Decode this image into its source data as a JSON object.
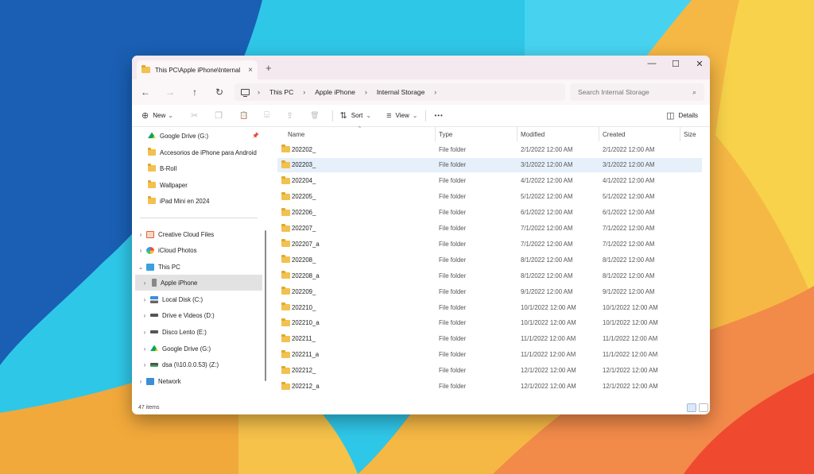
{
  "window": {
    "tab_title": "This PC\\Apple iPhone\\Internal",
    "close_tab_glyph": "×",
    "new_tab_glyph": "+",
    "minimize_glyph": "—",
    "maximize_glyph": "☐",
    "close_glyph": "✕"
  },
  "nav": {
    "back_glyph": "←",
    "forward_glyph": "→",
    "up_glyph": "↑",
    "refresh_glyph": "↻",
    "separator_glyph": "›",
    "breadcrumbs": [
      "This PC",
      "Apple iPhone",
      "Internal Storage"
    ],
    "search_placeholder": "Search Internal Storage",
    "search_glyph": "⌕"
  },
  "toolbar": {
    "new_glyph": "⊕",
    "new_label": "New",
    "dropdown_glyph": "⌄",
    "cut_glyph": "✂",
    "copy_glyph": "❐",
    "paste_glyph": "📋",
    "rename_glyph": "⌸",
    "share_glyph": "⇪",
    "delete_glyph": "🗑",
    "sort_glyph": "⇅",
    "sort_label": "Sort",
    "view_glyph": "≡",
    "view_label": "View",
    "more_glyph": "•••",
    "details_glyph": "◫",
    "details_label": "Details"
  },
  "sidebar": {
    "chevron_right": "›",
    "chevron_down": "⌄",
    "pin_glyph": "📌",
    "quick_access": [
      {
        "label": "Google Drive (G:)",
        "icon": "google-drive-icon",
        "pinned": true
      },
      {
        "label": "Accesorios de iPhone para Android",
        "icon": "folder-icon"
      },
      {
        "label": "B-Roll",
        "icon": "folder-icon"
      },
      {
        "label": "Wallpaper",
        "icon": "folder-icon"
      },
      {
        "label": "iPad Mini en 2024",
        "icon": "folder-icon"
      }
    ],
    "tree": [
      {
        "label": "Creative Cloud Files",
        "icon": "creative-cloud-icon"
      },
      {
        "label": "iCloud Photos",
        "icon": "icloud-photos-icon"
      },
      {
        "label": "This PC",
        "icon": "this-pc-icon",
        "expanded": true
      },
      {
        "label": "Apple iPhone",
        "icon": "iphone-icon",
        "selected": true
      },
      {
        "label": "Local Disk (C:)",
        "icon": "local-disk-icon"
      },
      {
        "label": "Drive e Videos (D:)",
        "icon": "drive-icon"
      },
      {
        "label": "Disco Lento (E:)",
        "icon": "drive-icon"
      },
      {
        "label": "Google Drive (G:)",
        "icon": "google-drive-icon"
      },
      {
        "label": "dsa (\\\\10.0.0.53) (Z:)",
        "icon": "network-drive-icon"
      },
      {
        "label": "Network",
        "icon": "network-icon"
      }
    ]
  },
  "file_list": {
    "sort_caret": "^",
    "columns": [
      "Name",
      "Type",
      "Modified",
      "Created",
      "Size"
    ],
    "rows": [
      {
        "name": "202202_",
        "type": "File folder",
        "modified": "2/1/2022 12:00 AM",
        "created": "2/1/2022 12:00 AM"
      },
      {
        "name": "202203_",
        "type": "File folder",
        "modified": "3/1/2022 12:00 AM",
        "created": "3/1/2022 12:00 AM",
        "selected": true
      },
      {
        "name": "202204_",
        "type": "File folder",
        "modified": "4/1/2022 12:00 AM",
        "created": "4/1/2022 12:00 AM"
      },
      {
        "name": "202205_",
        "type": "File folder",
        "modified": "5/1/2022 12:00 AM",
        "created": "5/1/2022 12:00 AM"
      },
      {
        "name": "202206_",
        "type": "File folder",
        "modified": "6/1/2022 12:00 AM",
        "created": "6/1/2022 12:00 AM"
      },
      {
        "name": "202207_",
        "type": "File folder",
        "modified": "7/1/2022 12:00 AM",
        "created": "7/1/2022 12:00 AM"
      },
      {
        "name": "202207_a",
        "type": "File folder",
        "modified": "7/1/2022 12:00 AM",
        "created": "7/1/2022 12:00 AM"
      },
      {
        "name": "202208_",
        "type": "File folder",
        "modified": "8/1/2022 12:00 AM",
        "created": "8/1/2022 12:00 AM"
      },
      {
        "name": "202208_a",
        "type": "File folder",
        "modified": "8/1/2022 12:00 AM",
        "created": "8/1/2022 12:00 AM"
      },
      {
        "name": "202209_",
        "type": "File folder",
        "modified": "9/1/2022 12:00 AM",
        "created": "9/1/2022 12:00 AM"
      },
      {
        "name": "202210_",
        "type": "File folder",
        "modified": "10/1/2022 12:00 AM",
        "created": "10/1/2022 12:00 AM"
      },
      {
        "name": "202210_a",
        "type": "File folder",
        "modified": "10/1/2022 12:00 AM",
        "created": "10/1/2022 12:00 AM"
      },
      {
        "name": "202211_",
        "type": "File folder",
        "modified": "11/1/2022 12:00 AM",
        "created": "11/1/2022 12:00 AM"
      },
      {
        "name": "202211_a",
        "type": "File folder",
        "modified": "11/1/2022 12:00 AM",
        "created": "11/1/2022 12:00 AM"
      },
      {
        "name": "202212_",
        "type": "File folder",
        "modified": "12/1/2022 12:00 AM",
        "created": "12/1/2022 12:00 AM"
      },
      {
        "name": "202212_a",
        "type": "File folder",
        "modified": "12/1/2022 12:00 AM",
        "created": "12/1/2022 12:00 AM"
      }
    ]
  },
  "status": {
    "item_count": "47 items"
  },
  "colors": {
    "accent": "#0067c0",
    "folder": "#f2c14e",
    "selection": "#e6f0fb"
  }
}
